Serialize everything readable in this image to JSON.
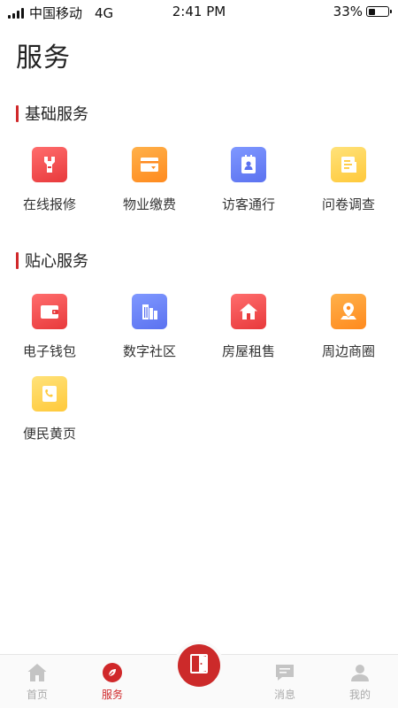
{
  "status_bar": {
    "carrier": "中国移动",
    "network": "4G",
    "time": "2:41 PM",
    "battery": "33%",
    "battery_level": 0.33
  },
  "page": {
    "title": "服务"
  },
  "sections": [
    {
      "title": "基础服务",
      "items": [
        {
          "label": "在线报修",
          "icon": "wrench-icon",
          "color": "red"
        },
        {
          "label": "物业缴费",
          "icon": "card-icon",
          "color": "orange"
        },
        {
          "label": "访客通行",
          "icon": "visitor-icon",
          "color": "blue"
        },
        {
          "label": "问卷调查",
          "icon": "survey-icon",
          "color": "yellow"
        }
      ]
    },
    {
      "title": "贴心服务",
      "items": [
        {
          "label": "电子钱包",
          "icon": "wallet-icon",
          "color": "red"
        },
        {
          "label": "数字社区",
          "icon": "buildings-icon",
          "color": "blue"
        },
        {
          "label": "房屋租售",
          "icon": "house-icon",
          "color": "red"
        },
        {
          "label": "周边商圈",
          "icon": "map-pin-icon",
          "color": "orange"
        },
        {
          "label": "便民黄页",
          "icon": "phone-book-icon",
          "color": "yellow"
        }
      ]
    }
  ],
  "tab_bar": {
    "items": [
      {
        "label": "首页",
        "icon": "home-icon",
        "active": false
      },
      {
        "label": "服务",
        "icon": "leaf-icon",
        "active": true
      },
      {
        "label": "",
        "icon": "door-icon",
        "active": false
      },
      {
        "label": "消息",
        "icon": "message-icon",
        "active": false
      },
      {
        "label": "我的",
        "icon": "user-icon",
        "active": false
      }
    ]
  },
  "colors": {
    "accent": "#d0282a",
    "red": "#e8393b",
    "orange": "#ff8a1e",
    "blue": "#5b72f0",
    "yellow": "#ffc93a",
    "tab_inactive": "#aaaaaa"
  }
}
